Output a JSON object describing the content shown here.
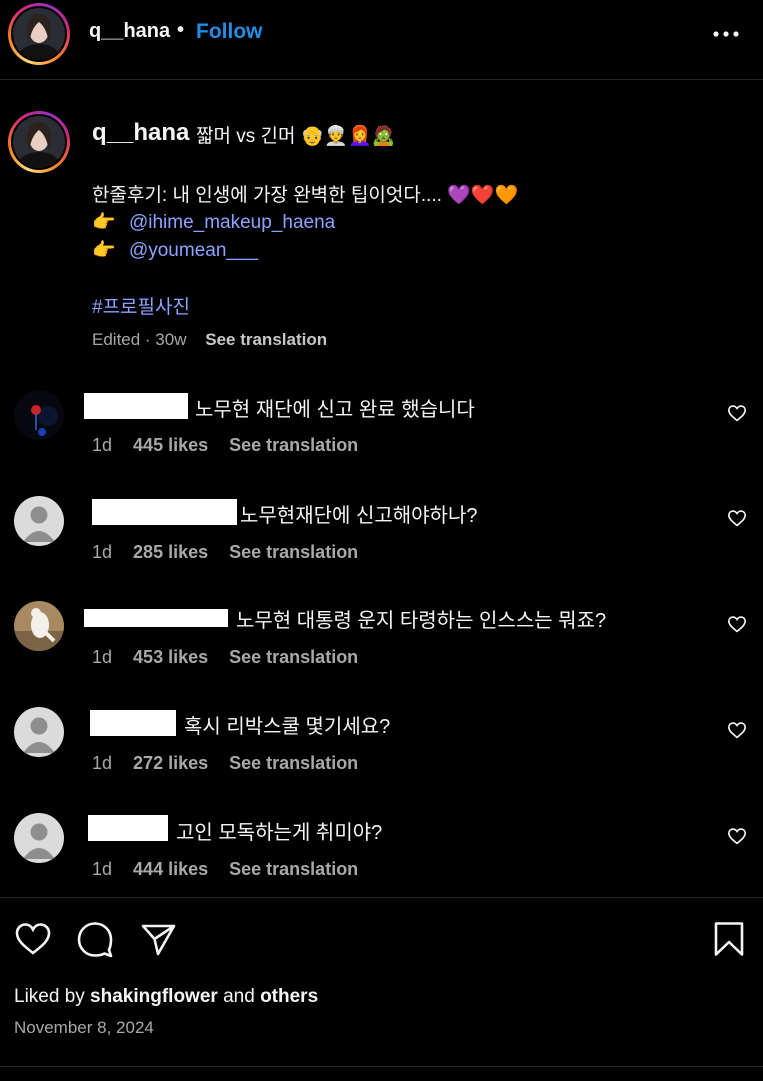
{
  "header": {
    "username": "q__hana",
    "separator": "•",
    "follow_label": "Follow",
    "more_icon": "more-horizontal-icon"
  },
  "caption": {
    "username": "q__hana",
    "title": "짧머 vs 긴머 👴👳‍♀️👩‍🦰🧟",
    "review": "한줄후기: 내 인생에 가장 완벽한 팁이엇다.... 💜❤️🧡",
    "mention1_pointer": "👉",
    "mention1": "@ihime_makeup_haena",
    "mention2_pointer": "👉",
    "mention2": "@youmean___",
    "hashtag": "#프로필사진",
    "meta_edited": "Edited · 30w",
    "see_translation": "See translation"
  },
  "comments": [
    {
      "text": "노무현 재단에 신고 완료 했습니다",
      "age": "1d",
      "likes": "445 likes",
      "see_translation": "See translation"
    },
    {
      "text": "노무현재단에 신고해야하나?",
      "age": "1d",
      "likes": "285 likes",
      "see_translation": "See translation"
    },
    {
      "text": "노무현 대통령 운지 타령하는 인스스는 뭐죠?",
      "age": "1d",
      "likes": "453 likes",
      "see_translation": "See translation"
    },
    {
      "text": "혹시 리박스쿨 몇기세요?",
      "age": "1d",
      "likes": "272 likes",
      "see_translation": "See translation"
    },
    {
      "text": "고인 모독하는게 취미야?",
      "age": "1d",
      "likes": "444 likes",
      "see_translation": "See translation"
    }
  ],
  "actions": {
    "like_icon": "heart-icon",
    "comment_icon": "comment-icon",
    "share_icon": "send-icon",
    "save_icon": "bookmark-icon"
  },
  "liked_by": {
    "prefix": "Liked by ",
    "user": "shakingflower",
    "middle": " and ",
    "others": "others"
  },
  "date": "November 8, 2024",
  "colors": {
    "background": "#000000",
    "follow_blue": "#1d8fe8",
    "mention": "#8ea3ff",
    "muted": "#a8a8a8"
  }
}
